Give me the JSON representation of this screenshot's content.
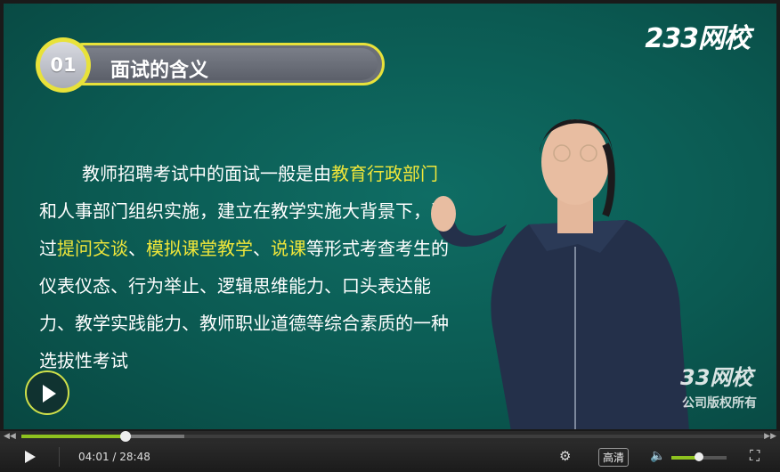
{
  "logo": "233网校",
  "section": {
    "number": "01",
    "title": "面试的含义"
  },
  "paragraph": [
    {
      "text": "教师招聘考试中的面试一般是由",
      "hl": false
    },
    {
      "text": "教育行政部门",
      "hl": true
    },
    {
      "text": "和人事部门组织实施，建立在教学实施大背景下，通过",
      "hl": false
    },
    {
      "text": "提问交谈",
      "hl": true
    },
    {
      "text": "、",
      "hl": false
    },
    {
      "text": "模拟课堂教学",
      "hl": true
    },
    {
      "text": "、",
      "hl": false
    },
    {
      "text": "说课",
      "hl": true
    },
    {
      "text": "等形式考查考生的仪表仪态、行为举止、逻辑思维能力、口头表达能力、教学实践能力、教师职业道德等综合素质的一种选拔性考试",
      "hl": false
    }
  ],
  "watermark": {
    "logo": "33网校",
    "copyright": "公司版权所有"
  },
  "player": {
    "current_time": "04:01",
    "separator": " / ",
    "duration": "28:48",
    "progress_fraction": 0.14,
    "buffered_fraction": 0.22,
    "quality_label": "高清",
    "volume_fraction": 0.5,
    "accent_color": "#8ec21f"
  }
}
